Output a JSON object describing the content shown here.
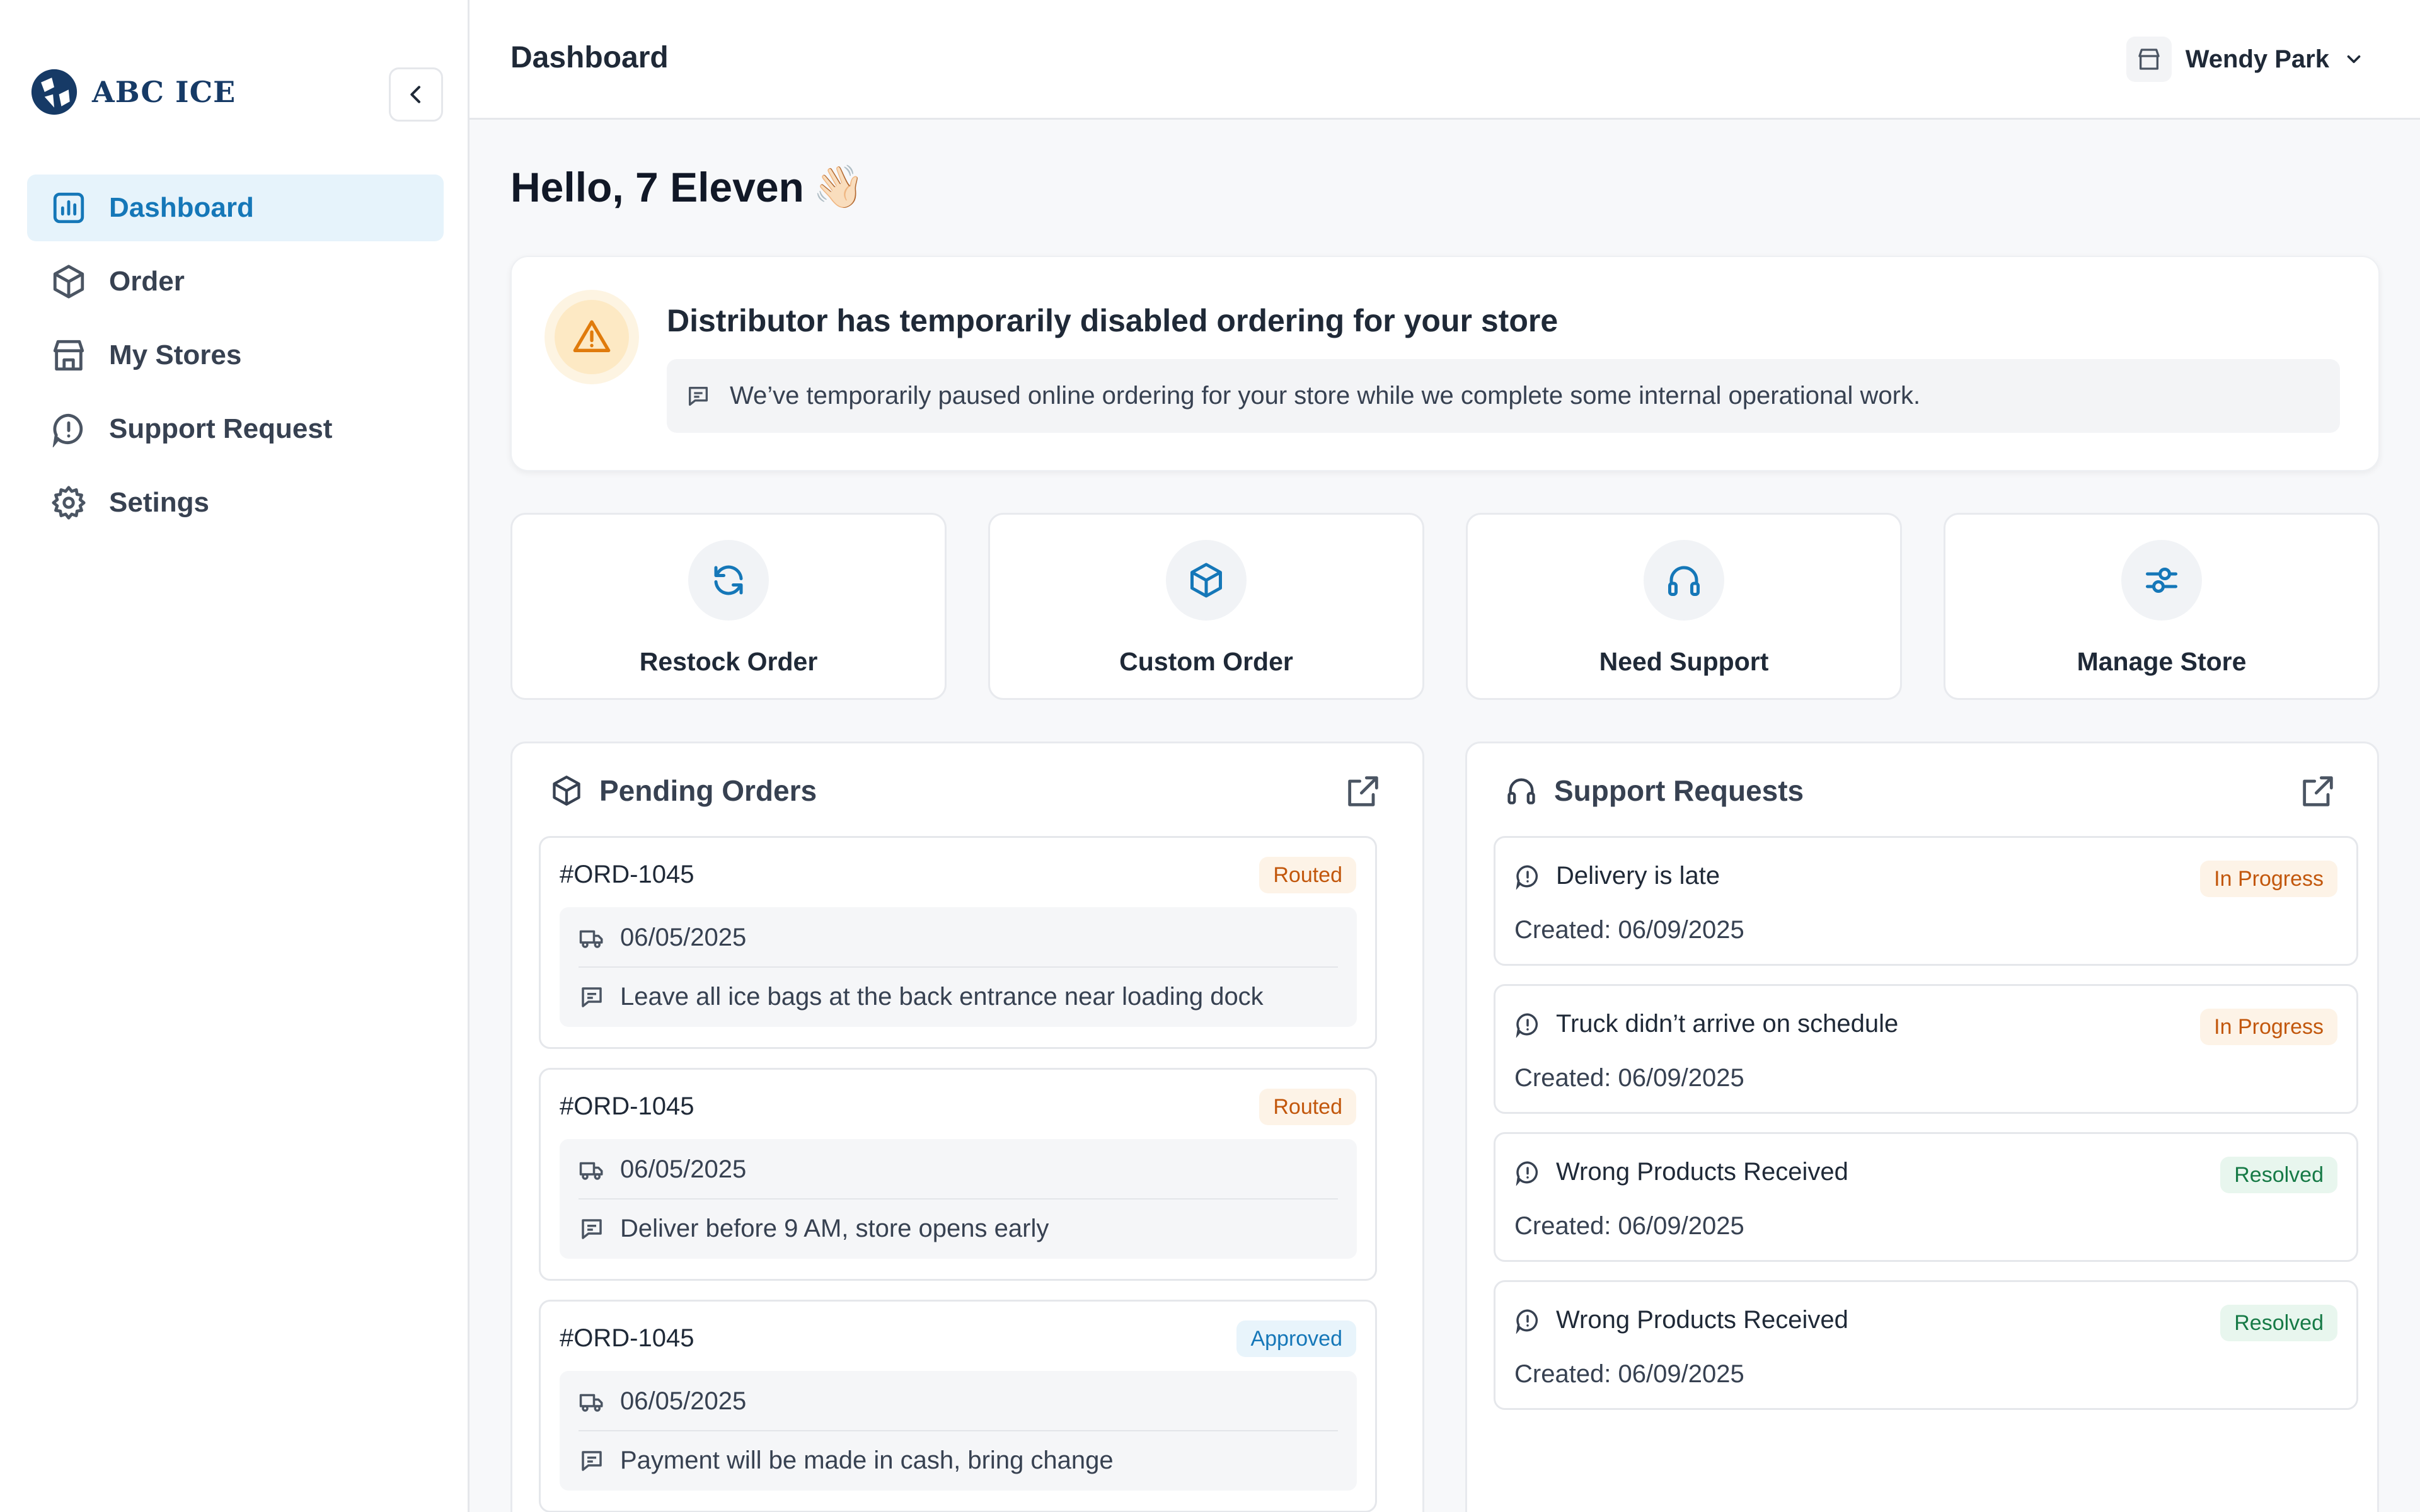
{
  "brand": {
    "name": "ABC ICE"
  },
  "sidebar": {
    "items": [
      {
        "label": "Dashboard",
        "icon": "bar-chart-icon",
        "active": true
      },
      {
        "label": "Order",
        "icon": "box-icon"
      },
      {
        "label": "My Stores",
        "icon": "store-icon"
      },
      {
        "label": "Support Request",
        "icon": "message-alert-icon"
      },
      {
        "label": "Setings",
        "icon": "gear-icon"
      }
    ]
  },
  "header": {
    "title": "Dashboard",
    "user_name": "Wendy Park"
  },
  "main": {
    "greeting": "Hello, 7 Eleven",
    "greeting_emoji": "👋🏻",
    "alert": {
      "title": "Distributor has temporarily disabled ordering for your store",
      "message": "We’ve temporarily paused online ordering for your store while we complete some internal operational work."
    },
    "actions": [
      {
        "label": "Restock Order",
        "icon": "refresh-icon"
      },
      {
        "label": "Custom Order",
        "icon": "box-icon"
      },
      {
        "label": "Need Support",
        "icon": "headphones-icon"
      },
      {
        "label": "Manage Store",
        "icon": "sliders-icon"
      }
    ],
    "pending_orders": {
      "title": "Pending Orders",
      "orders": [
        {
          "id": "#ORD-1045",
          "status": "Routed",
          "date": "06/05/2025",
          "note": "Leave all ice bags at the back entrance near loading dock"
        },
        {
          "id": "#ORD-1045",
          "status": "Routed",
          "date": "06/05/2025",
          "note": "Deliver before 9 AM, store opens early"
        },
        {
          "id": "#ORD-1045",
          "status": "Approved",
          "date": "06/05/2025",
          "note": "Payment will be made in cash, bring change"
        }
      ]
    },
    "support_requests": {
      "title": "Support Requests",
      "requests": [
        {
          "title": "Delivery is late",
          "status": "In Progress",
          "created": "Created: 06/09/2025"
        },
        {
          "title": "Truck didn’t arrive on schedule",
          "status": "In Progress",
          "created": "Created: 06/09/2025"
        },
        {
          "title": "Wrong Products Received",
          "status": "Resolved",
          "created": "Created: 06/09/2025"
        },
        {
          "title": "Wrong Products Received",
          "status": "Resolved",
          "created": "Created: 06/09/2025"
        }
      ]
    }
  },
  "colors": {
    "accent": "#1577b8",
    "warning": "#e07b0c",
    "success": "#167a46"
  }
}
